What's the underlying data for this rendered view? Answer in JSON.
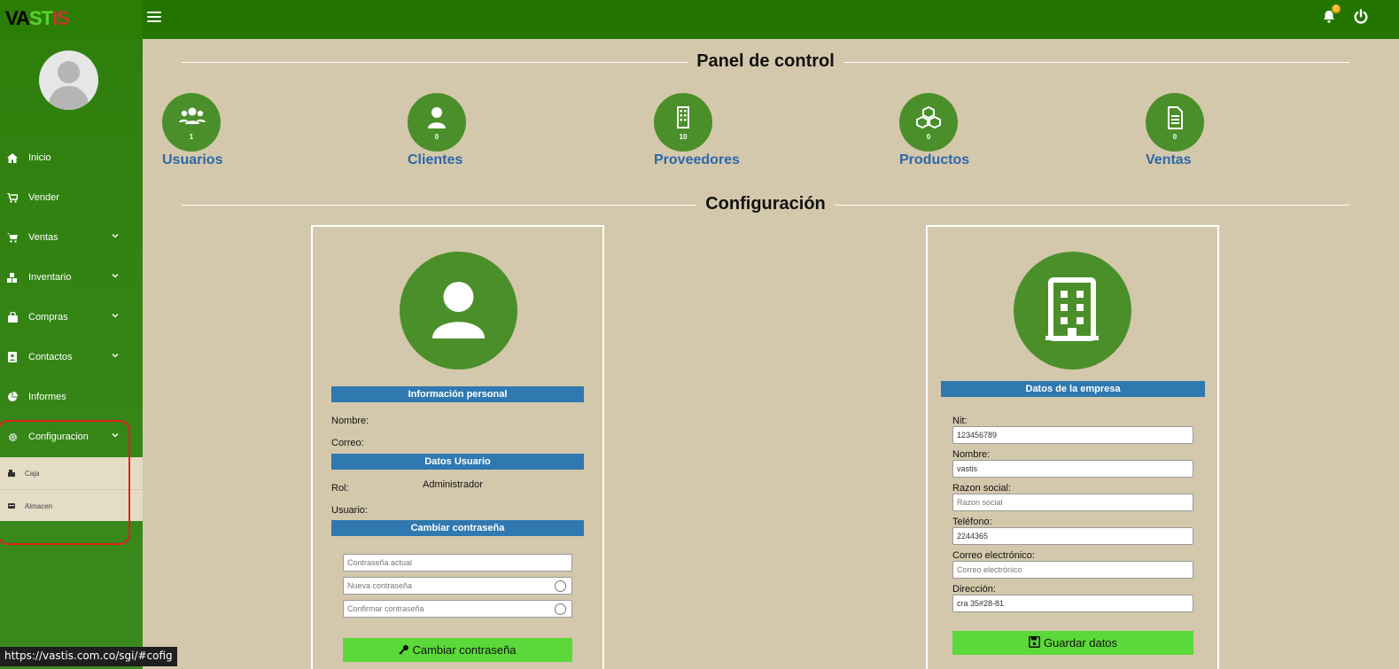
{
  "brand": {
    "part1": "VA",
    "part2": "ST",
    "part3": "IS"
  },
  "header": {
    "notifications_count": "0"
  },
  "sidebar": {
    "items": [
      {
        "label": "Inicio"
      },
      {
        "label": "Vender"
      },
      {
        "label": "Ventas"
      },
      {
        "label": "Inventario"
      },
      {
        "label": "Compras"
      },
      {
        "label": "Contactos"
      },
      {
        "label": "Informes"
      },
      {
        "label": "Configuracion"
      }
    ],
    "submenu": [
      {
        "label": "Caja"
      },
      {
        "label": "Almacen"
      }
    ]
  },
  "status_bar": {
    "url": "https://vastis.com.co/sgi/#cofig"
  },
  "dashboard": {
    "title": "Panel de control",
    "stats": [
      {
        "label": "Usuarios",
        "count": "1"
      },
      {
        "label": "Clientes",
        "count": "0"
      },
      {
        "label": "Proveedores",
        "count": "10"
      },
      {
        "label": "Productos",
        "count": "0"
      },
      {
        "label": "Ventas",
        "count": "0"
      }
    ]
  },
  "config": {
    "title": "Configuración",
    "personal": {
      "section_personal": "Información personal",
      "nombre_label": "Nombre:",
      "correo_label": "Correo:",
      "section_usuario": "Datos Usuario",
      "rol_label": "Rol:",
      "rol_value": "Administrador",
      "usuario_label": "Usuario:",
      "section_password": "Cambiar contraseña",
      "current_password_placeholder": "Contraseña actual",
      "new_password_placeholder": "Nueva contraseña",
      "confirm_password_placeholder": "Confirmar contraseña",
      "change_button": "Cambiar contraseña"
    },
    "company": {
      "section": "Datos de la empresa",
      "nit_label": "Nit:",
      "nit_value": "123456789",
      "nombre_label": "Nombre:",
      "nombre_value": "vastis",
      "razon_label": "Razon social:",
      "razon_placeholder": "Razon social",
      "telefono_label": "Teléfono:",
      "telefono_value": "2244365",
      "correo_label": "Correo electrónico:",
      "correo_placeholder": "Correo electrónico",
      "direccion_label": "Dirección:",
      "direccion_value": "cra 35#28-81",
      "save_button": "Guardar datos"
    }
  },
  "colors": {
    "topbar": "#237500",
    "sidebar": "#3a8a1e",
    "accent_circle": "#4a8f2a",
    "section_bar": "#2f78b0",
    "button": "#5bd93a",
    "page_bg": "#d4c8ac"
  }
}
